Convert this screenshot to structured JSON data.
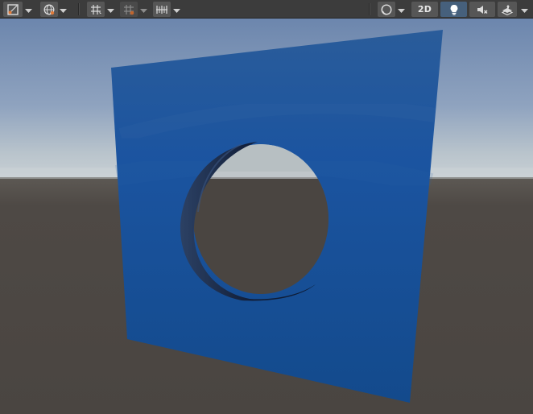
{
  "window": {
    "type": "scene-view"
  },
  "toolbar": {
    "left_tools": [
      {
        "name": "shading-mode-icon"
      },
      {
        "name": "global-local-icon"
      },
      {
        "name": "grid-snap-icon"
      },
      {
        "name": "increment-snap-icon"
      },
      {
        "name": "vertex-snap-icon"
      }
    ],
    "right_tools": {
      "draw_mode_icon": "sphere-shading-icon",
      "mode_2d_label": "2D",
      "lighting_icon": "lightbulb-icon",
      "lighting_active": true,
      "audio_icon": "speaker-mute-icon",
      "effects_icon": "layers-effects-icon"
    }
  },
  "scene": {
    "sky_top_color": "#6c86ad",
    "horizon_color": "#c7cfd4",
    "ground_color": "#4a4541",
    "panel_color": "#134a8c",
    "panel_highlight_color": "#2a5c9a",
    "hole_rim_color": "#0c1a33"
  }
}
